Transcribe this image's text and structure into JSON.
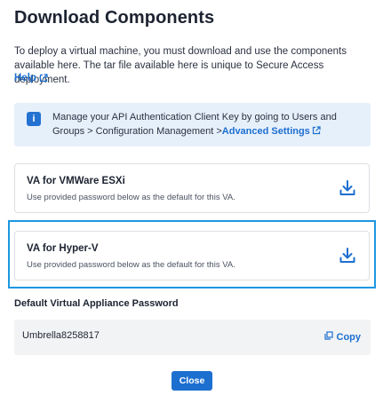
{
  "dialog": {
    "title": "Download Components",
    "intro": "To deploy a virtual machine, you must download and use the components available here. The tar file available here is unique to Secure Access deployment.",
    "help_label": "Help"
  },
  "info_banner": {
    "icon": "info-icon",
    "text": "Manage your API Authentication Client Key by going to Users and Groups > Configuration Management >",
    "link_label": "Advanced Settings"
  },
  "components": [
    {
      "title": "VA for VMWare ESXi",
      "subtitle": "Use provided password below as the default for this VA.",
      "icon": "download-icon"
    },
    {
      "title": "VA for Hyper-V",
      "subtitle": "Use provided password below as the default for this VA.",
      "icon": "download-icon"
    }
  ],
  "password": {
    "label": "Default Virtual Appliance Password",
    "value": "Umbrella8258817",
    "copy_label": "Copy"
  },
  "footer": {
    "close_label": "Close"
  },
  "colors": {
    "accent": "#1d6fcf",
    "info_bg": "#e6f0fb",
    "selection": "#1c98e0"
  }
}
